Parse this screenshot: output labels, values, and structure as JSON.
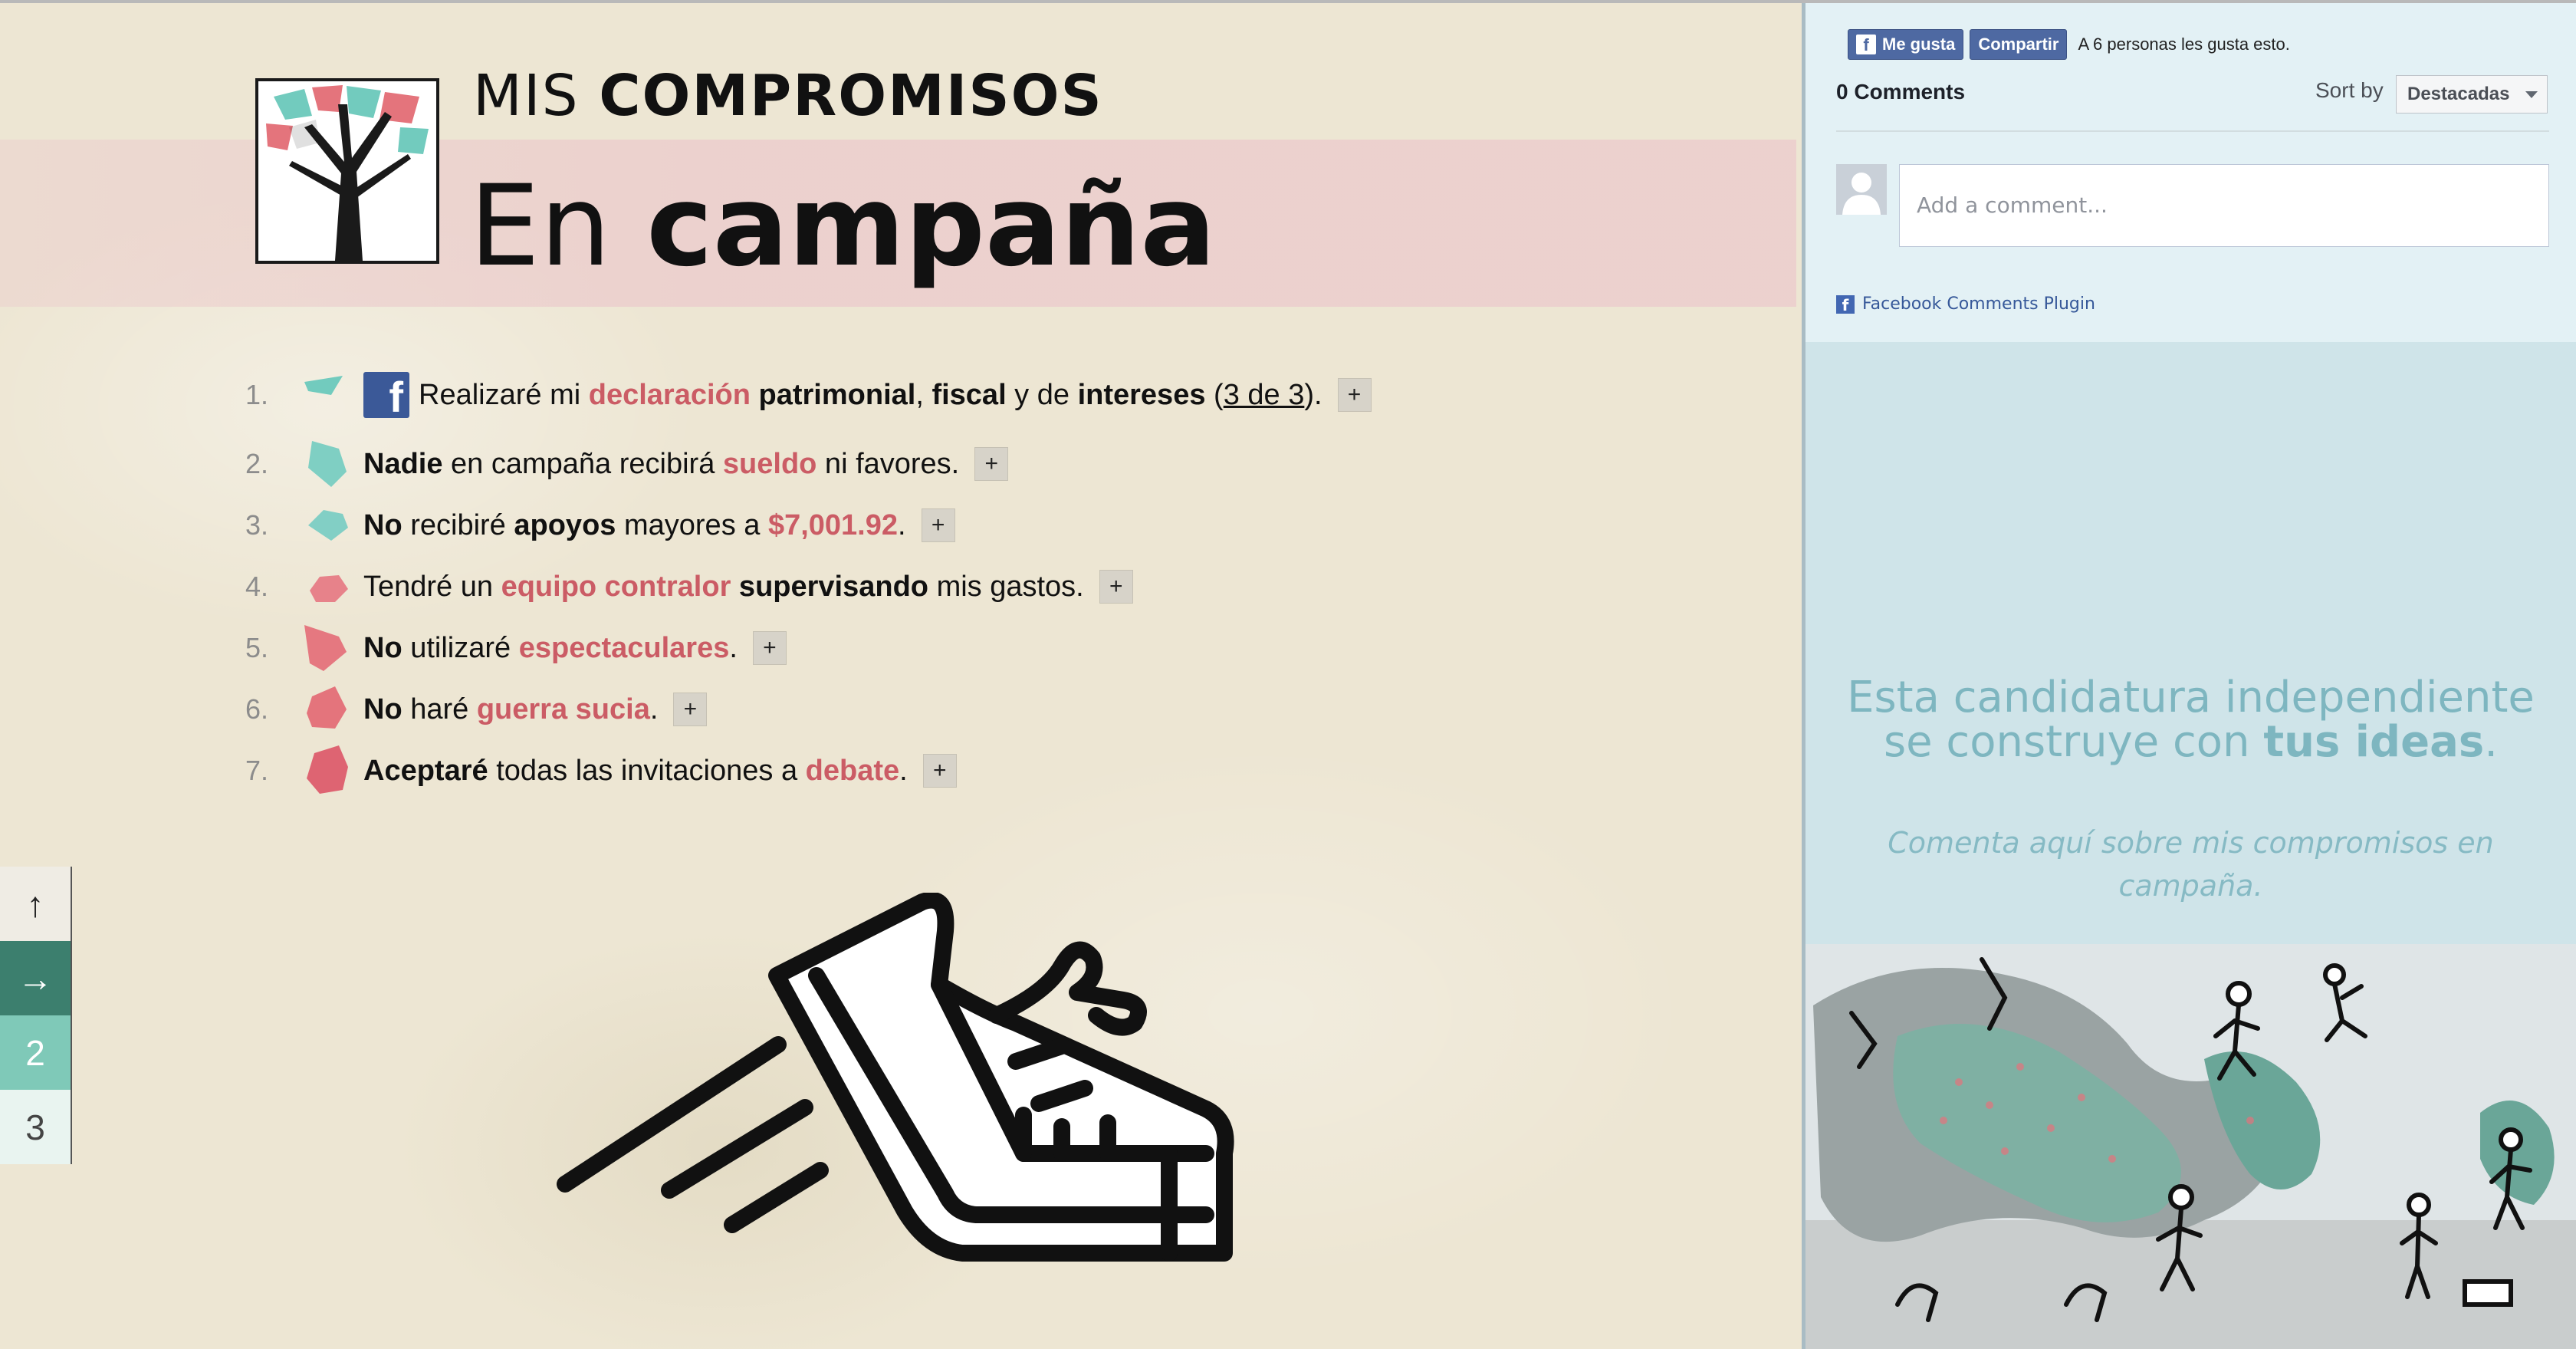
{
  "header": {
    "eyebrow_light": "MIS",
    "eyebrow_bold": "COMPROMISOS",
    "headline_light": "En",
    "headline_bold": "campaña"
  },
  "commitments": [
    {
      "num": "1.",
      "parts": [
        {
          "t": "Realizaré mi ",
          "s": ""
        },
        {
          "t": "declaración",
          "s": "hl"
        },
        {
          "t": " patrimonial",
          "s": "bold"
        },
        {
          "t": ", ",
          "s": ""
        },
        {
          "t": "fiscal",
          "s": "bold"
        },
        {
          "t": " y de ",
          "s": ""
        },
        {
          "t": "intereses",
          "s": "bold"
        },
        {
          "t": " (",
          "s": ""
        },
        {
          "t": "3 de 3",
          "s": "link"
        },
        {
          "t": ").",
          "s": ""
        }
      ],
      "has_fb": true,
      "shape_color": "#72cbbe"
    },
    {
      "num": "2.",
      "parts": [
        {
          "t": "Nadie",
          "s": "bold"
        },
        {
          "t": " en campaña recibirá ",
          "s": ""
        },
        {
          "t": "sueldo",
          "s": "hl"
        },
        {
          "t": " ni favores.",
          "s": ""
        }
      ],
      "has_fb": false,
      "shape_color": "#7fcfc3"
    },
    {
      "num": "3.",
      "parts": [
        {
          "t": "No",
          "s": "bold"
        },
        {
          "t": " recibiré ",
          "s": ""
        },
        {
          "t": "apoyos",
          "s": "bold"
        },
        {
          "t": " mayores a ",
          "s": ""
        },
        {
          "t": "$7,001.92",
          "s": "hl"
        },
        {
          "t": ".",
          "s": ""
        }
      ],
      "has_fb": false,
      "shape_color": "#82cfc5"
    },
    {
      "num": "4.",
      "parts": [
        {
          "t": "Tendré un ",
          "s": ""
        },
        {
          "t": "equipo contralor",
          "s": "hl"
        },
        {
          "t": " supervisando",
          "s": "bold"
        },
        {
          "t": " mis gastos.",
          "s": ""
        }
      ],
      "has_fb": false,
      "shape_color": "#e7828a"
    },
    {
      "num": "5.",
      "parts": [
        {
          "t": "No",
          "s": "bold"
        },
        {
          "t": " utilizaré ",
          "s": ""
        },
        {
          "t": "espectaculares",
          "s": "hl"
        },
        {
          "t": ".",
          "s": ""
        }
      ],
      "has_fb": false,
      "shape_color": "#e57880"
    },
    {
      "num": "6.",
      "parts": [
        {
          "t": "No",
          "s": "bold"
        },
        {
          "t": " haré ",
          "s": ""
        },
        {
          "t": "guerra sucia",
          "s": "hl"
        },
        {
          "t": ".",
          "s": ""
        }
      ],
      "has_fb": false,
      "shape_color": "#e4747c"
    },
    {
      "num": "7.",
      "parts": [
        {
          "t": "Aceptaré",
          "s": "bold"
        },
        {
          "t": " todas las invitaciones a ",
          "s": ""
        },
        {
          "t": "debate",
          "s": "hl"
        },
        {
          "t": ".",
          "s": ""
        }
      ],
      "has_fb": false,
      "shape_color": "#de6472"
    }
  ],
  "plus_label": "+",
  "side_nav": {
    "up": "↑",
    "right": "→",
    "page2": "2",
    "page3": "3"
  },
  "fb": {
    "like_label": "Me gusta",
    "share_label": "Compartir",
    "like_count": "A 6 personas les gusta esto.",
    "comments_count": "0 Comments",
    "sort_label": "Sort by",
    "sort_value": "Destacadas",
    "comment_placeholder": "Add a comment...",
    "plugin_label": "Facebook Comments Plugin"
  },
  "promo": {
    "line1": "Esta candidatura independiente",
    "line2_light": "se construye con ",
    "line2_bold": "tus ideas",
    "line2_end": ".",
    "subtitle_1": "Comenta aquí sobre mis compromisos en",
    "subtitle_2": "campaña."
  },
  "colors": {
    "accent": "#cb5c65",
    "teal": "#72cbbe",
    "dark_teal": "#3c7f6e",
    "facebook": "#4e69a2"
  }
}
